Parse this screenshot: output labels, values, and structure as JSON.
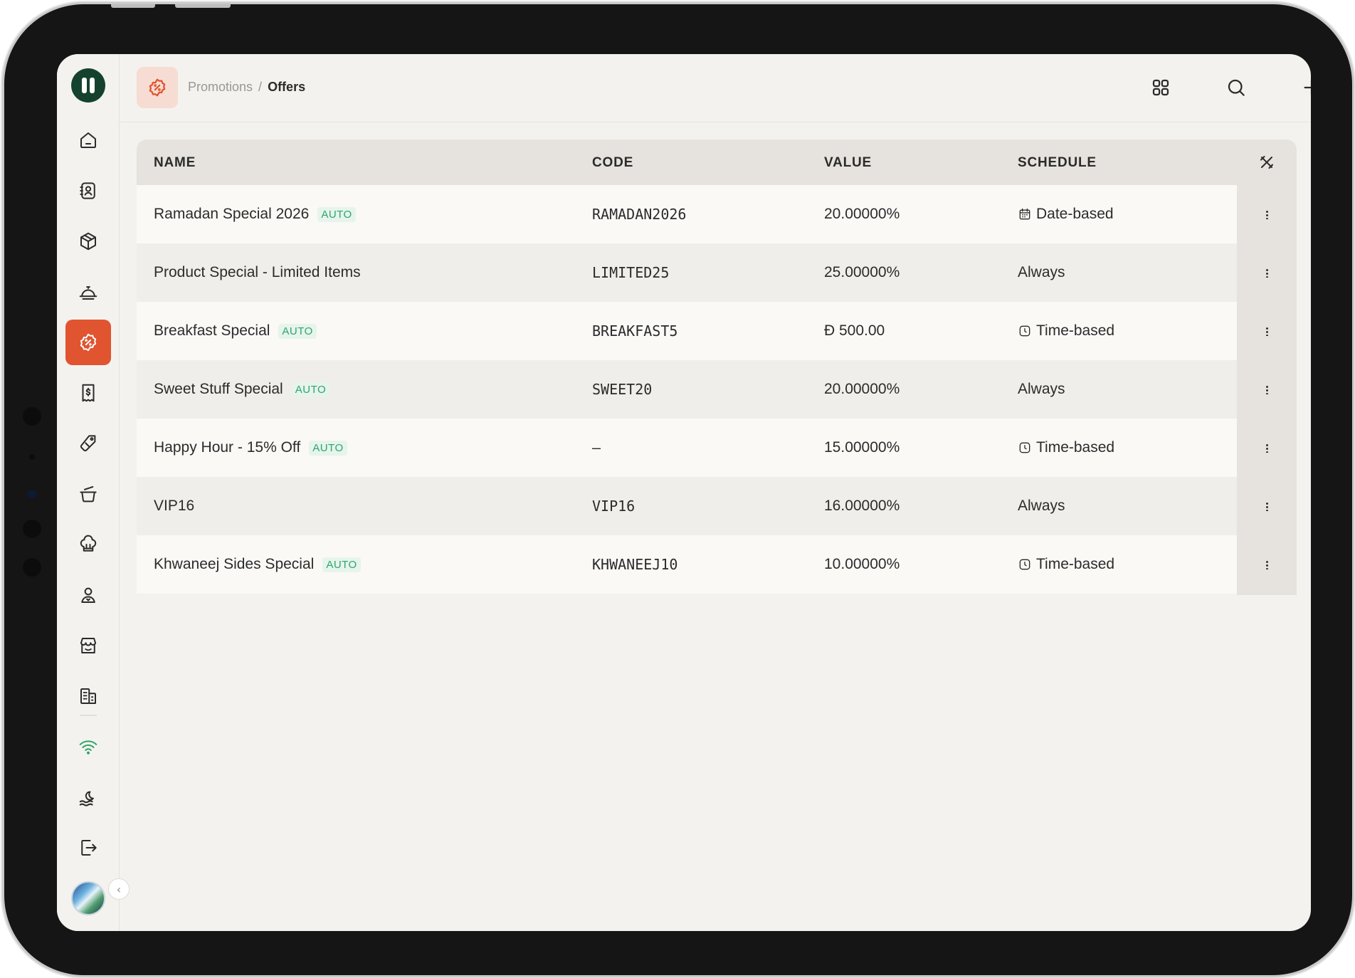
{
  "header": {
    "breadcrumb_parent": "Promotions",
    "breadcrumb_sep": "/",
    "breadcrumb_current": "Offers",
    "actions": [
      "grid-icon",
      "search-icon",
      "plus-icon"
    ]
  },
  "sidebar": {
    "items": [
      {
        "icon": "home-icon"
      },
      {
        "icon": "contacts-icon"
      },
      {
        "icon": "box-icon"
      },
      {
        "icon": "food-dome-icon"
      },
      {
        "icon": "promotions-badge-icon",
        "active": true
      },
      {
        "icon": "receipt-icon"
      },
      {
        "icon": "tag-icon"
      },
      {
        "icon": "pot-icon"
      },
      {
        "icon": "chef-hat-icon"
      },
      {
        "icon": "user-icon"
      },
      {
        "icon": "store-icon"
      },
      {
        "icon": "buildings-icon"
      },
      {
        "icon": "wifi-icon"
      },
      {
        "icon": "weather-icon"
      },
      {
        "icon": "logout-icon"
      }
    ],
    "collapse_glyph": "‹"
  },
  "table": {
    "columns": [
      "NAME",
      "CODE",
      "VALUE",
      "SCHEDULE"
    ],
    "rows": [
      {
        "name": "Ramadan Special 2026",
        "auto": "AUTO",
        "code": "RAMADAN2026",
        "value": "20.00000%",
        "schedule": "Date-based",
        "schedule_icon": "calendar-icon"
      },
      {
        "name": "Product Special - Limited Items",
        "auto": "",
        "code": "LIMITED25",
        "value": "25.00000%",
        "schedule": "Always",
        "schedule_icon": ""
      },
      {
        "name": "Breakfast Special",
        "auto": "AUTO",
        "code": "BREAKFAST5",
        "value": "Ð 500.00",
        "schedule": "Time-based",
        "schedule_icon": "clock-icon"
      },
      {
        "name": "Sweet Stuff Special",
        "auto": "AUTO",
        "code": "SWEET20",
        "value": "20.00000%",
        "schedule": "Always",
        "schedule_icon": ""
      },
      {
        "name": "Happy Hour - 15% Off",
        "auto": "AUTO",
        "code": "—",
        "value": "15.00000%",
        "schedule": "Time-based",
        "schedule_icon": "clock-icon"
      },
      {
        "name": "VIP16",
        "auto": "",
        "code": "VIP16",
        "value": "16.00000%",
        "schedule": "Always",
        "schedule_icon": ""
      },
      {
        "name": "Khwaneej Sides Special",
        "auto": "AUTO",
        "code": "KHWANEEJ10",
        "value": "10.00000%",
        "schedule": "Time-based",
        "schedule_icon": "clock-icon"
      }
    ]
  },
  "colors": {
    "accent": "#e0542f",
    "auto_badge": "#2fa56a",
    "logo": "#14422f"
  }
}
